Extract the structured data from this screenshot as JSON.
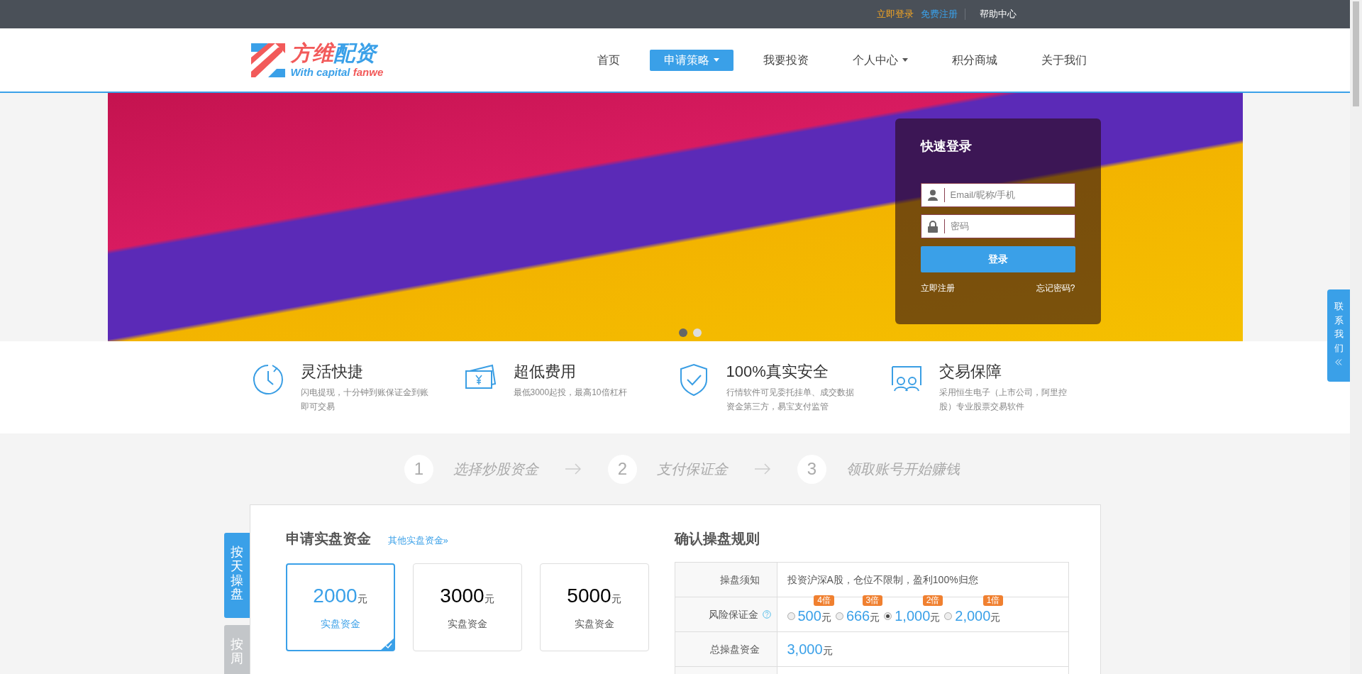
{
  "top_bar": {
    "links": [
      {
        "label": "立即登录",
        "kind": "login"
      },
      {
        "label": "免费注册",
        "kind": "register"
      },
      {
        "label": "帮助中心",
        "kind": "help"
      }
    ]
  },
  "header": {
    "logo": {
      "title_a": "方维",
      "title_b": "配资",
      "subtitle_a": "With capital ",
      "subtitle_b": "fanwe"
    },
    "nav": [
      {
        "label": "首页",
        "selected": false,
        "dropdown": false
      },
      {
        "label": "申请策略",
        "selected": true,
        "dropdown": true
      },
      {
        "label": "我要投资",
        "selected": false,
        "dropdown": false
      },
      {
        "label": "个人中心",
        "selected": false,
        "dropdown": true
      },
      {
        "label": "积分商城",
        "selected": false,
        "dropdown": false
      },
      {
        "label": "关于我们",
        "selected": false,
        "dropdown": false
      }
    ]
  },
  "banner": {
    "dots": [
      {
        "selected": true
      },
      {
        "selected": false
      }
    ],
    "login": {
      "title": "快速登录",
      "username_placeholder": "Email/昵称/手机",
      "password_placeholder": "密码",
      "button": "登录",
      "register": "立即注册",
      "forgot": "忘记密码?"
    }
  },
  "features": [
    {
      "kind": "clock",
      "title": "灵活快捷",
      "desc": "闪电提现，十分钟到账保证金到账即可交易"
    },
    {
      "kind": "money",
      "title": "超低费用",
      "desc": "最低3000起投，最高10倍杠杆"
    },
    {
      "kind": "shield",
      "title": "100%真实安全",
      "desc": "行情软件可见委托挂单、成交数据资金第三方，易宝支付监管"
    },
    {
      "kind": "people",
      "title": "交易保障",
      "desc": "采用恒生电子（上市公司，阿里控股）专业股票交易软件"
    }
  ],
  "steps": [
    {
      "number": "1",
      "label": "选择炒股资金"
    },
    {
      "number": "2",
      "label": "支付保证金"
    },
    {
      "number": "3",
      "label": "领取账号开始赚钱"
    }
  ],
  "side_tabs": [
    {
      "label": "按天操盘",
      "selected": true
    },
    {
      "label": "按周",
      "selected": false
    }
  ],
  "apply": {
    "title": "申请实盘资金",
    "other_link": "其他实盘资金»",
    "amounts": [
      {
        "amount": "2000",
        "unit": "元",
        "label": "实盘资金",
        "selected": true
      },
      {
        "amount": "3000",
        "unit": "元",
        "label": "实盘资金",
        "selected": false
      },
      {
        "amount": "5000",
        "unit": "元",
        "label": "实盘资金",
        "selected": false
      }
    ]
  },
  "rules": {
    "title": "确认操盘规则",
    "rows": [
      {
        "kind": "text",
        "label": "操盘须知",
        "value": "投资沪深A股，仓位不限制，盈利100%归您"
      },
      {
        "kind": "options",
        "label": "风险保证金",
        "help": true,
        "options": [
          {
            "amount": "500",
            "unit": "元",
            "badge": "4倍",
            "selected": false
          },
          {
            "amount": "666",
            "unit": "元",
            "badge": "3倍",
            "selected": false
          },
          {
            "amount": "1,000",
            "unit": "元",
            "badge": "2倍",
            "selected": true
          },
          {
            "amount": "2,000",
            "unit": "元",
            "badge": "1倍",
            "selected": false
          }
        ]
      },
      {
        "kind": "amount",
        "label": "总操盘资金",
        "amount": "3,000",
        "unit": "元"
      }
    ]
  },
  "contact_tab": {
    "label": "联系我们"
  }
}
